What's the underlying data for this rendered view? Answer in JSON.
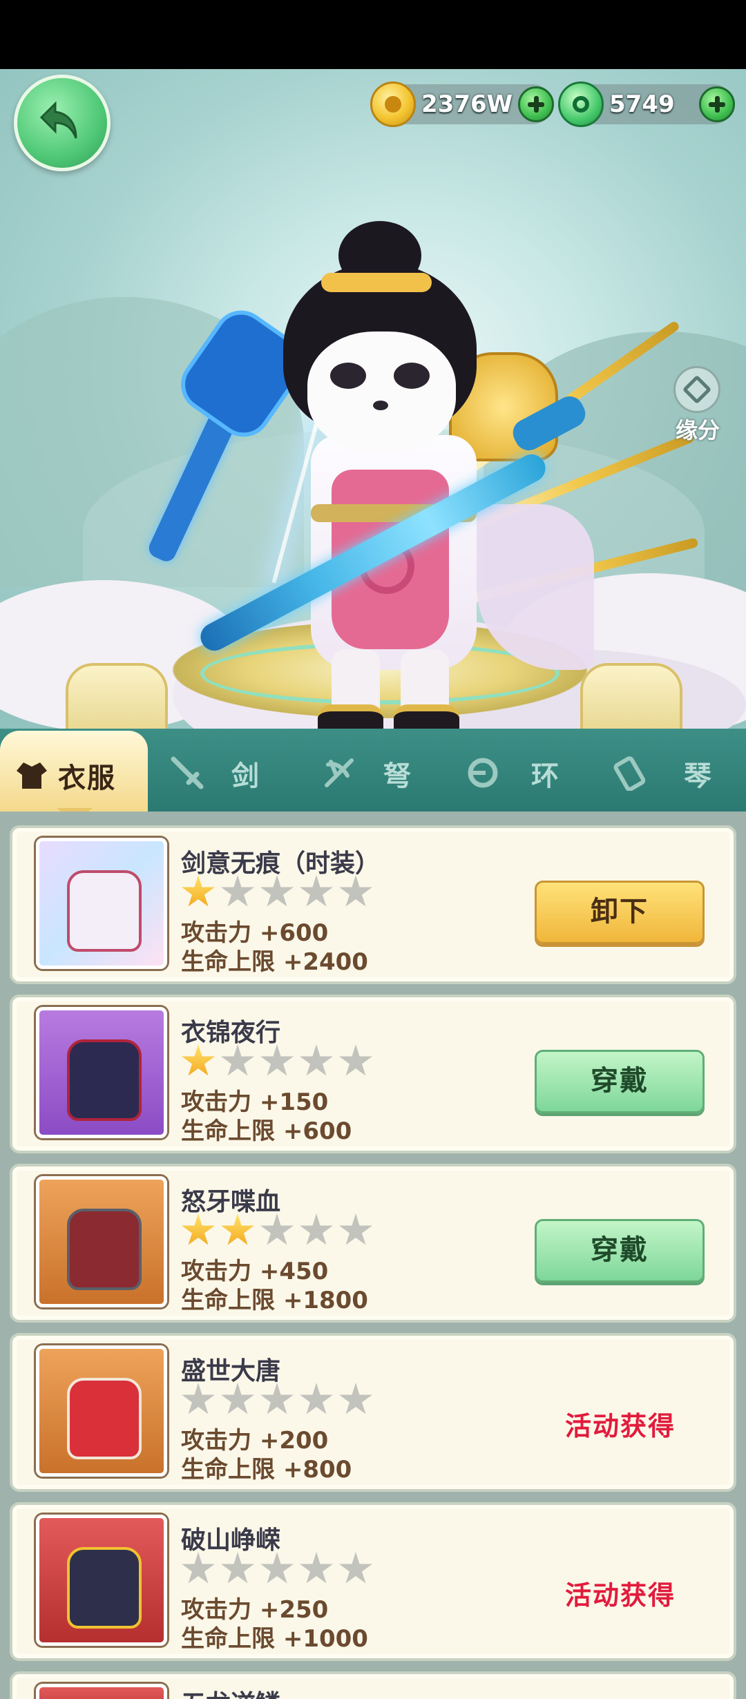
{
  "currency": {
    "gold": {
      "icon": "paw-coin-icon",
      "value": "2376W"
    },
    "jade": {
      "icon": "jade-coin-icon",
      "value": "5749"
    }
  },
  "side": {
    "fate_label": "缘分",
    "fate_icon": "fate-emblem-icon"
  },
  "tabs": [
    {
      "label": "衣服",
      "icon": "clothes-icon",
      "active": true
    },
    {
      "label": "剑",
      "icon": "sword-icon",
      "active": false
    },
    {
      "label": "弩",
      "icon": "crossbow-icon",
      "active": false
    },
    {
      "label": "环",
      "icon": "ring-icon",
      "active": false
    },
    {
      "label": "琴",
      "icon": "zither-icon",
      "active": false
    }
  ],
  "items": [
    {
      "name": "剑意无痕（时装）",
      "stars": 1,
      "max_stars": 5,
      "attack": "攻击力 +600",
      "hp": "生命上限 +2400",
      "action": "卸下",
      "action_type": "unequip"
    },
    {
      "name": "衣锦夜行",
      "stars": 1,
      "max_stars": 5,
      "attack": "攻击力 +150",
      "hp": "生命上限 +600",
      "action": "穿戴",
      "action_type": "equip"
    },
    {
      "name": "怒牙喋血",
      "stars": 2,
      "max_stars": 5,
      "attack": "攻击力 +450",
      "hp": "生命上限 +1800",
      "action": "穿戴",
      "action_type": "equip"
    },
    {
      "name": "盛世大唐",
      "stars": 0,
      "max_stars": 5,
      "attack": "攻击力 +200",
      "hp": "生命上限 +800",
      "action": "活动获得",
      "action_type": "event"
    },
    {
      "name": "破山峥嵘",
      "stars": 0,
      "max_stars": 5,
      "attack": "攻击力 +250",
      "hp": "生命上限 +1000",
      "action": "活动获得",
      "action_type": "event"
    }
  ],
  "partial_item": {
    "name": "五龙逆鳞"
  },
  "colors": {
    "event_text": "#e21b3d",
    "tab_bar": "#2b7a72",
    "card_bg": "#fbf8e9"
  }
}
